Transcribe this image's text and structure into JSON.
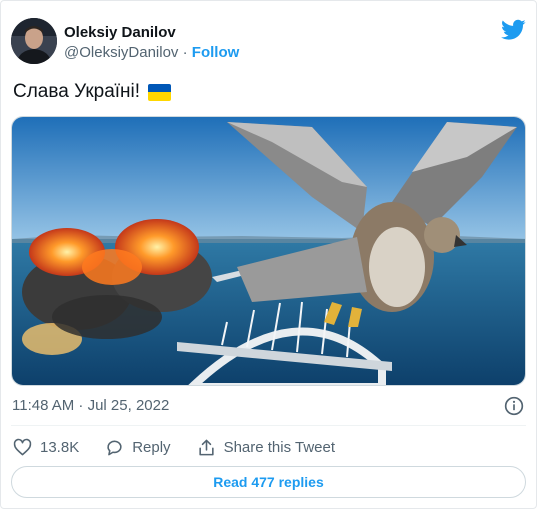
{
  "author": {
    "name": "Oleksiy Danilov",
    "handle": "@OleksiyDanilov",
    "separator": "·",
    "follow_label": "Follow"
  },
  "tweet": {
    "text": "Слава Україні!",
    "emoji": "ukraine-flag",
    "timestamp": "11:48 AM · Jul 25, 2022"
  },
  "actions": {
    "likes_count": "13.8K",
    "reply_label": "Reply",
    "share_label": "Share this Tweet"
  },
  "read_replies_label": "Read 477 replies",
  "colors": {
    "accent": "#1d9bf0",
    "secondary_text": "#536471",
    "flag_blue": "#0057b7",
    "flag_yellow": "#ffd700"
  },
  "icons": {
    "logo": "twitter-bird-icon",
    "info": "info-icon",
    "like": "heart-icon",
    "reply": "reply-bubble-icon",
    "share": "share-icon"
  }
}
